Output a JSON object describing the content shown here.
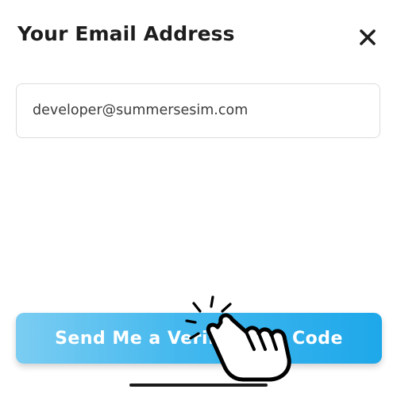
{
  "dialog": {
    "title": "Your Email Address",
    "close_icon": "close-x-icon"
  },
  "email": {
    "value": "developer@summersesim.com"
  },
  "send_button": {
    "label": "Send Me a Verification Code",
    "gradient_colors": [
      "#7bcdf2",
      "#1ea8ea"
    ]
  },
  "overlay": {
    "pointer_icon": "tap-hand-icon"
  }
}
